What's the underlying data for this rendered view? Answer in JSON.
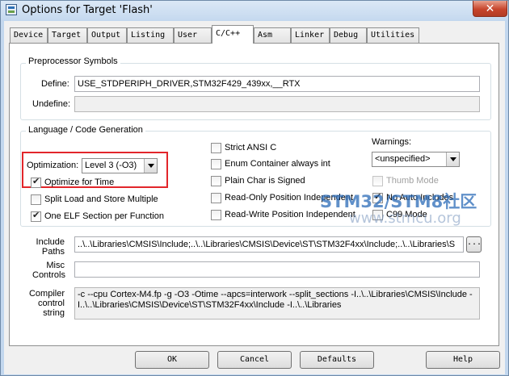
{
  "window": {
    "title": "Options for Target 'Flash'",
    "close_label": "✕"
  },
  "tabs": [
    {
      "label": "Device"
    },
    {
      "label": "Target"
    },
    {
      "label": "Output"
    },
    {
      "label": "Listing"
    },
    {
      "label": "User"
    },
    {
      "label": "C/C++",
      "active": true
    },
    {
      "label": "Asm"
    },
    {
      "label": "Linker"
    },
    {
      "label": "Debug"
    },
    {
      "label": "Utilities"
    }
  ],
  "preprocessor": {
    "group_label": "Preprocessor Symbols",
    "define_label": "Define:",
    "define_value": "USE_STDPERIPH_DRIVER,STM32F429_439xx,__RTX",
    "undefine_label": "Undefine:",
    "undefine_value": ""
  },
  "codegen": {
    "group_label": "Language / Code Generation",
    "optimization_label": "Optimization:",
    "optimization_value": "Level 3 (-O3)",
    "options": {
      "optimize_for_time": {
        "label": "Optimize for Time",
        "checked": true
      },
      "split_load_store": {
        "label": "Split Load and Store Multiple",
        "checked": false
      },
      "one_elf_section": {
        "label": "One ELF Section per Function",
        "checked": true
      },
      "strict_ansi_c": {
        "label": "Strict ANSI C",
        "checked": false
      },
      "enum_container": {
        "label": "Enum Container always int",
        "checked": false
      },
      "plain_char_signed": {
        "label": "Plain Char is Signed",
        "checked": false
      },
      "ro_position_independent": {
        "label": "Read-Only Position Independent",
        "checked": false
      },
      "rw_position_independent": {
        "label": "Read-Write Position Independent",
        "checked": false
      },
      "thumb_mode": {
        "label": "Thumb Mode",
        "checked": false,
        "disabled": true
      },
      "no_auto_includes": {
        "label": "No Auto Includes",
        "checked": true
      },
      "c99_mode": {
        "label": "C99 Mode",
        "checked": false
      }
    },
    "warnings_label": "Warnings:",
    "warnings_value": "<unspecified>"
  },
  "paths": {
    "include_label": "Include\nPaths",
    "include_value": "..\\..\\Libraries\\CMSIS\\Include;..\\..\\Libraries\\CMSIS\\Device\\ST\\STM32F4xx\\Include;..\\..\\Libraries\\S",
    "browse_label": "...",
    "misc_label": "Misc\nControls",
    "misc_value": "",
    "compiler_label": "Compiler\ncontrol\nstring",
    "compiler_value": "-c --cpu Cortex-M4.fp -g -O3 -Otime --apcs=interwork --split_sections -I..\\..\\Libraries\\CMSIS\\Include -I..\\..\\Libraries\\CMSIS\\Device\\ST\\STM32F4xx\\Include -I..\\..\\Libraries"
  },
  "buttons": {
    "ok": "OK",
    "cancel": "Cancel",
    "defaults": "Defaults",
    "help": "Help"
  },
  "watermark": {
    "line1": "STM32/STM8社区",
    "line2": "www.stmcu.org"
  },
  "colors": {
    "highlight": "#e2262b",
    "watermark": "#2b6bb7"
  }
}
